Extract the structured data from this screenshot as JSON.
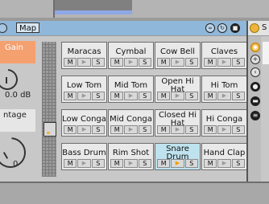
{
  "device": {
    "map_label": "Map",
    "gain_label": "Gain",
    "gain_value": "0.0 dB",
    "vintage_label": "ntage",
    "vintage_value": "0"
  },
  "pads": [
    {
      "name": "Maracas",
      "active": false,
      "playing": false
    },
    {
      "name": "Cymbal",
      "active": false,
      "playing": false
    },
    {
      "name": "Cow Bell",
      "active": false,
      "playing": false
    },
    {
      "name": "Claves",
      "active": false,
      "playing": false
    },
    {
      "name": "Low Tom",
      "active": false,
      "playing": false
    },
    {
      "name": "Mid Tom",
      "active": false,
      "playing": false
    },
    {
      "name": "Open Hi Hat",
      "active": false,
      "playing": false
    },
    {
      "name": "Hi Tom",
      "active": false,
      "playing": false
    },
    {
      "name": "Low Conga",
      "active": false,
      "playing": false
    },
    {
      "name": "Mid Conga",
      "active": false,
      "playing": false
    },
    {
      "name": "Closed Hi Hat",
      "active": false,
      "playing": false
    },
    {
      "name": "Hi Conga",
      "active": false,
      "playing": false
    },
    {
      "name": "Bass Drum",
      "active": false,
      "playing": false
    },
    {
      "name": "Rim Shot",
      "active": false,
      "playing": false
    },
    {
      "name": "Snare Drum",
      "active": true,
      "playing": true
    },
    {
      "name": "Hand Clap",
      "active": false,
      "playing": false
    }
  ],
  "pad_buttons": {
    "mute": "M",
    "play": "▶",
    "solo": "S"
  },
  "right": {
    "title_letter": "S"
  },
  "icons": {
    "device_fold": "circle-icon",
    "header": [
      "loop-icon",
      "refresh-icon",
      "save-icon"
    ],
    "right": [
      "power-icon",
      "add-icon",
      "chevron-icon",
      "record-icon",
      "stop-icon",
      "list-icon"
    ]
  },
  "colors": {
    "accent": "#f5a06f",
    "active_pad": "#bfe3ee",
    "header": "#8fb7d9",
    "play_on": "#f0a000"
  }
}
